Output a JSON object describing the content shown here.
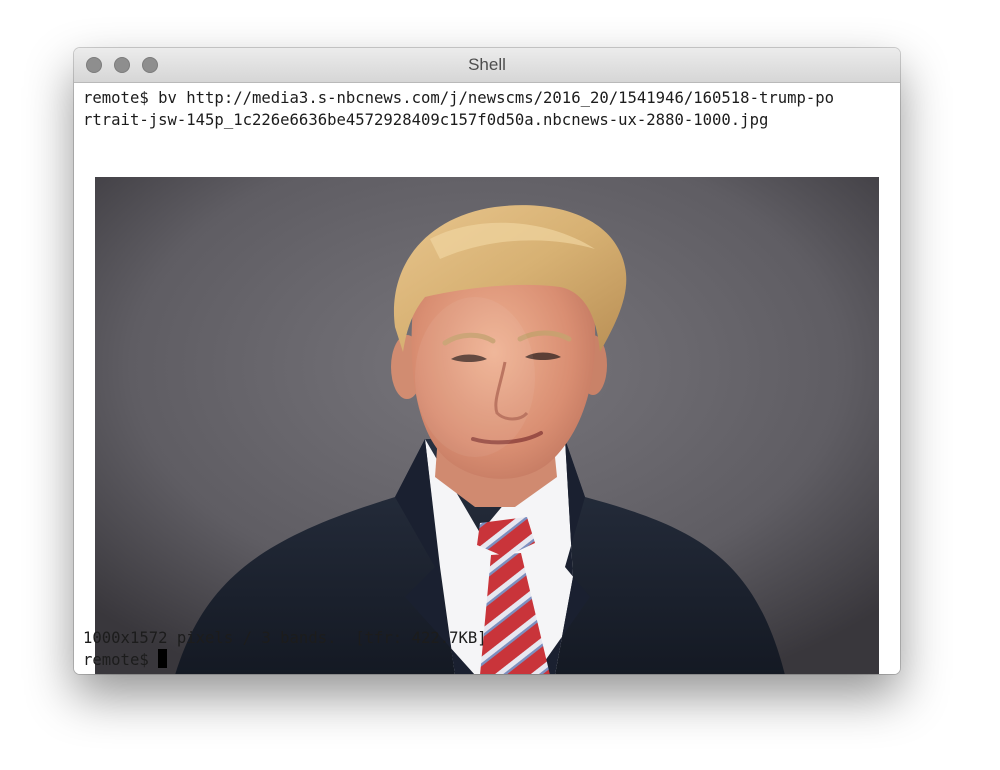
{
  "window": {
    "title": "Shell"
  },
  "terminal": {
    "command_line_1": "remote$ bv http://media3.s-nbcnews.com/j/newscms/2016_20/1541946/160518-trump-po",
    "command_line_2": "rtrait-jsw-145p_1c226e6636be4572928409c157f0d50a.nbcnews-ux-2880-1000.jpg",
    "output_line": "1000x1572 pixels / 3 bands.  [tfr: 422.7KB]",
    "prompt": "remote$ "
  },
  "image": {
    "description_icon": "portrait-photo"
  },
  "colors": {
    "traffic_lights": "#8e8e8e",
    "background": "#5f5d63",
    "suit": "#1e2431",
    "tie_red": "#c9343a"
  }
}
